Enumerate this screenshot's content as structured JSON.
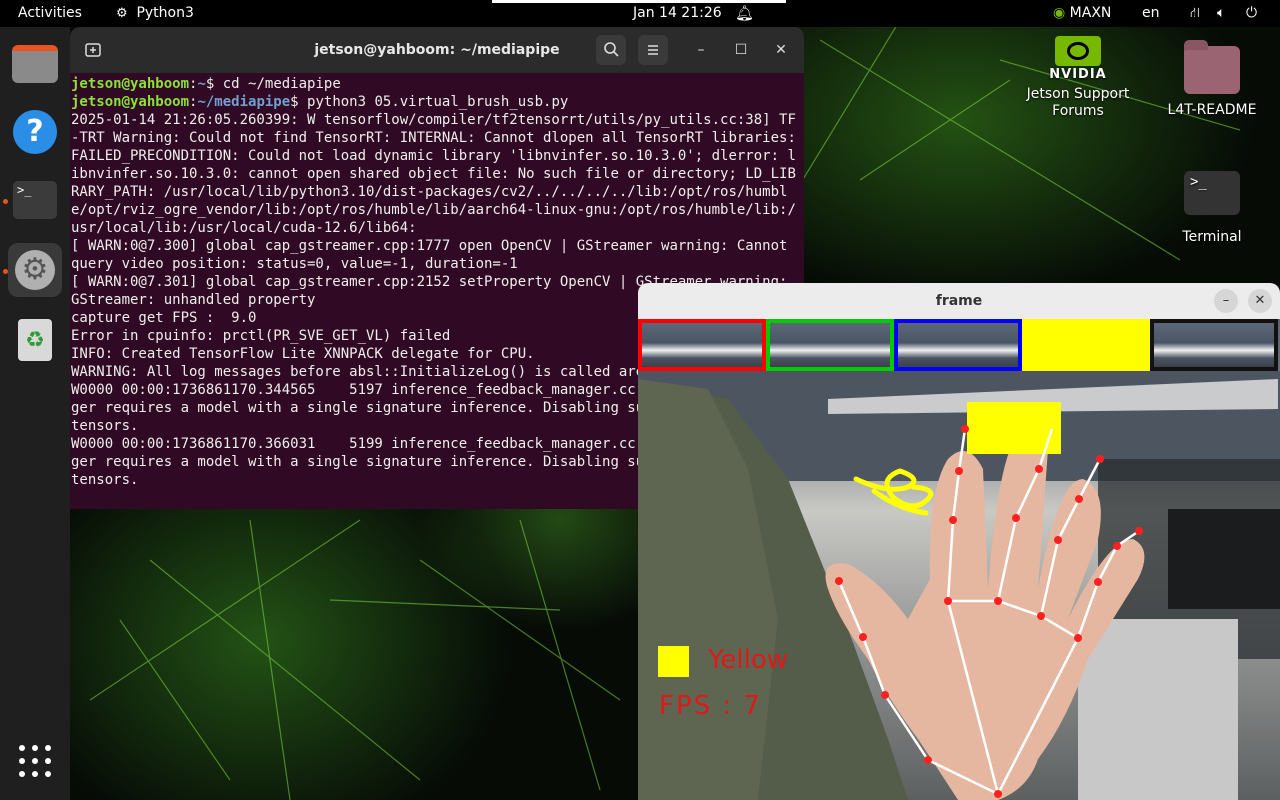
{
  "topbar": {
    "activities": "Activities",
    "app_name": "Python3",
    "datetime": "Jan 14  21:26",
    "power_mode": "MAXN",
    "language": "en"
  },
  "terminal": {
    "title": "jetson@yahboom: ~/mediapipe",
    "lines": [
      {
        "user": "jetson@yahboom",
        "path": "~",
        "cmd": "$ cd ~/mediapipe"
      },
      {
        "user": "jetson@yahboom",
        "path": "~/mediapipe",
        "cmd": "$ python3 05.virtual_brush_usb.py"
      },
      {
        "text": "2025-01-14 21:26:05.260399: W tensorflow/compiler/tf2tensorrt/utils/py_utils.cc:38] TF-TRT Warning: Could not find TensorRT: INTERNAL: Cannot dlopen all TensorRT libraries: FAILED_PRECONDITION: Could not load dynamic library 'libnvinfer.so.10.3.0'; dlerror: libnvinfer.so.10.3.0: cannot open shared object file: No such file or directory; LD_LIBRARY_PATH: /usr/local/lib/python3.10/dist-packages/cv2/../../../../lib:/opt/ros/humble/opt/rviz_ogre_vendor/lib:/opt/ros/humble/lib/aarch64-linux-gnu:/opt/ros/humble/lib:/usr/local/lib:/usr/local/cuda-12.6/lib64:"
      },
      {
        "text": "[ WARN:0@7.300] global cap_gstreamer.cpp:1777 open OpenCV | GStreamer warning: Cannot query video position: status=0, value=-1, duration=-1"
      },
      {
        "text": "[ WARN:0@7.301] global cap_gstreamer.cpp:2152 setProperty OpenCV | GStreamer warning: GStreamer: unhandled property"
      },
      {
        "text": "capture get FPS :  9.0"
      },
      {
        "text": "Error in cpuinfo: prctl(PR_SVE_GET_VL) failed"
      },
      {
        "text": "INFO: Created TensorFlow Lite XNNPACK delegate for CPU."
      },
      {
        "text": "WARNING: All log messages before absl::InitializeLog() is called are written to STDERR"
      },
      {
        "text": "W0000 00:00:1736861170.344565    5197 inference_feedback_manager.cc:114] Feedback manager requires a model with a single signature inference. Disabling support for feedback tensors."
      },
      {
        "text": "W0000 00:00:1736861170.366031    5199 inference_feedback_manager.cc:114] Feedback manager requires a model with a single signature inference. Disabling support for feedback tensors."
      }
    ]
  },
  "desktop_icons": [
    {
      "label": "Jetson Support Forums",
      "logo_text": "NVIDIA"
    },
    {
      "label": "L4T-README"
    },
    {
      "label": "Terminal"
    }
  ],
  "frame_window": {
    "title": "frame",
    "palette_colors": [
      "#ff0000",
      "#00cc00",
      "#0000ff",
      "#ffff00",
      "#000000"
    ],
    "selected_color_label": "Yellow",
    "selected_color_hex": "#ffff00",
    "fps_text": "FPS : 7"
  }
}
